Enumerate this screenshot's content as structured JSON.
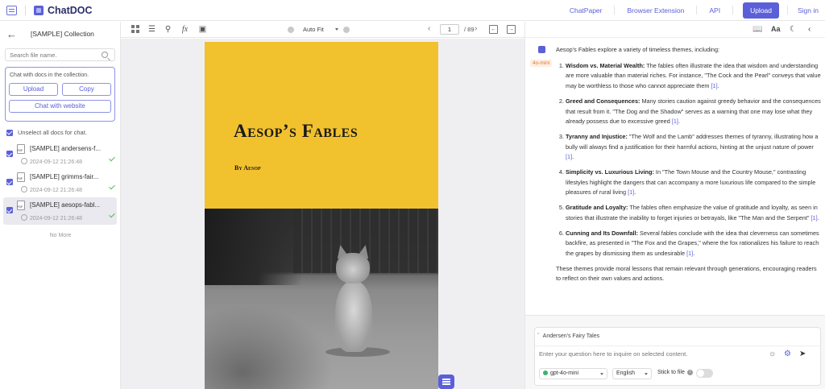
{
  "topbar": {
    "brand": "ChatDOC",
    "links": [
      "ChatPaper",
      "Browser Extension",
      "API"
    ],
    "upload": "Upload",
    "signin": "Sign in"
  },
  "sidebar": {
    "title": "[SAMPLE] Collection",
    "search_placeholder": "Search file name.",
    "panel_text": "Chat with docs in the collection.",
    "upload": "Upload",
    "copy": "Copy",
    "chat_website": "Chat with website",
    "unselect": "Unselect all docs for chat.",
    "docs": [
      {
        "name": "[SAMPLE] andersens-f...",
        "time": "2024-09-12 21:26:48"
      },
      {
        "name": "[SAMPLE] grimms-fair...",
        "time": "2024-09-12 21:26:48"
      },
      {
        "name": "[SAMPLE] aesops-fabl...",
        "time": "2024-09-12 21:26:48"
      }
    ],
    "no_more": "No More"
  },
  "pdf_toolbar": {
    "zoom": "Auto Fit",
    "page": "1",
    "total": "/ 89"
  },
  "pdf": {
    "title": "Aesop’s Fables",
    "author": "By Aesop"
  },
  "chat": {
    "model_tag": "4o-mini",
    "intro": "Aesop’s Fables explore a variety of timeless themes, including:",
    "items": [
      {
        "title": "Wisdom vs. Material Wealth:",
        "text": " The fables often illustrate the idea that wisdom and understanding are more valuable than material riches. For instance, \"The Cock and the Pearl\" conveys that value may be worthless to those who cannot appreciate them ",
        "cite": "[1]",
        "end": "."
      },
      {
        "title": "Greed and Consequences:",
        "text": " Many stories caution against greedy behavior and the consequences that result from it. \"The Dog and the Shadow\" serves as a warning that one may lose what they already possess due to excessive greed ",
        "cite": "[1]",
        "end": "."
      },
      {
        "title": "Tyranny and Injustice:",
        "text": " \"The Wolf and the Lamb\" addresses themes of tyranny, illustrating how a bully will always find a justification for their harmful actions, hinting at the unjust nature of power ",
        "cite": "[1]",
        "end": "."
      },
      {
        "title": "Simplicity vs. Luxurious Living:",
        "text": " In \"The Town Mouse and the Country Mouse,\" contrasting lifestyles highlight the dangers that can accompany a more luxurious life compared to the simple pleasures of rural living ",
        "cite": "[1]",
        "end": "."
      },
      {
        "title": "Gratitude and Loyalty:",
        "text": " The fables often emphasize the value of gratitude and loyalty, as seen in stories that illustrate the inability to forget injuries or betrayals, like \"The Man and the Serpent\" ",
        "cite": "[1]",
        "end": "."
      },
      {
        "title": "Cunning and Its Downfall:",
        "text": " Several fables conclude with the idea that cleverness can sometimes backfire, as presented in \"The Fox and the Grapes,\" where the fox rationalizes his failure to reach the grapes by dismissing them as undesirable ",
        "cite": "[1]",
        "end": "."
      }
    ],
    "outro": "These themes provide moral lessons that remain relevant through generations, encouraging readers to reflect on their own values and actions.",
    "ref_num": "1",
    "quote": "Andersen's Fairy Tales",
    "input_placeholder": "Enter your question here to inquire on selected content.",
    "model": "gpt-4o-mini",
    "language": "English",
    "stick": "Stick to file"
  },
  "colors": {
    "accent": "#5b60d8",
    "cover": "#f2c12e"
  }
}
